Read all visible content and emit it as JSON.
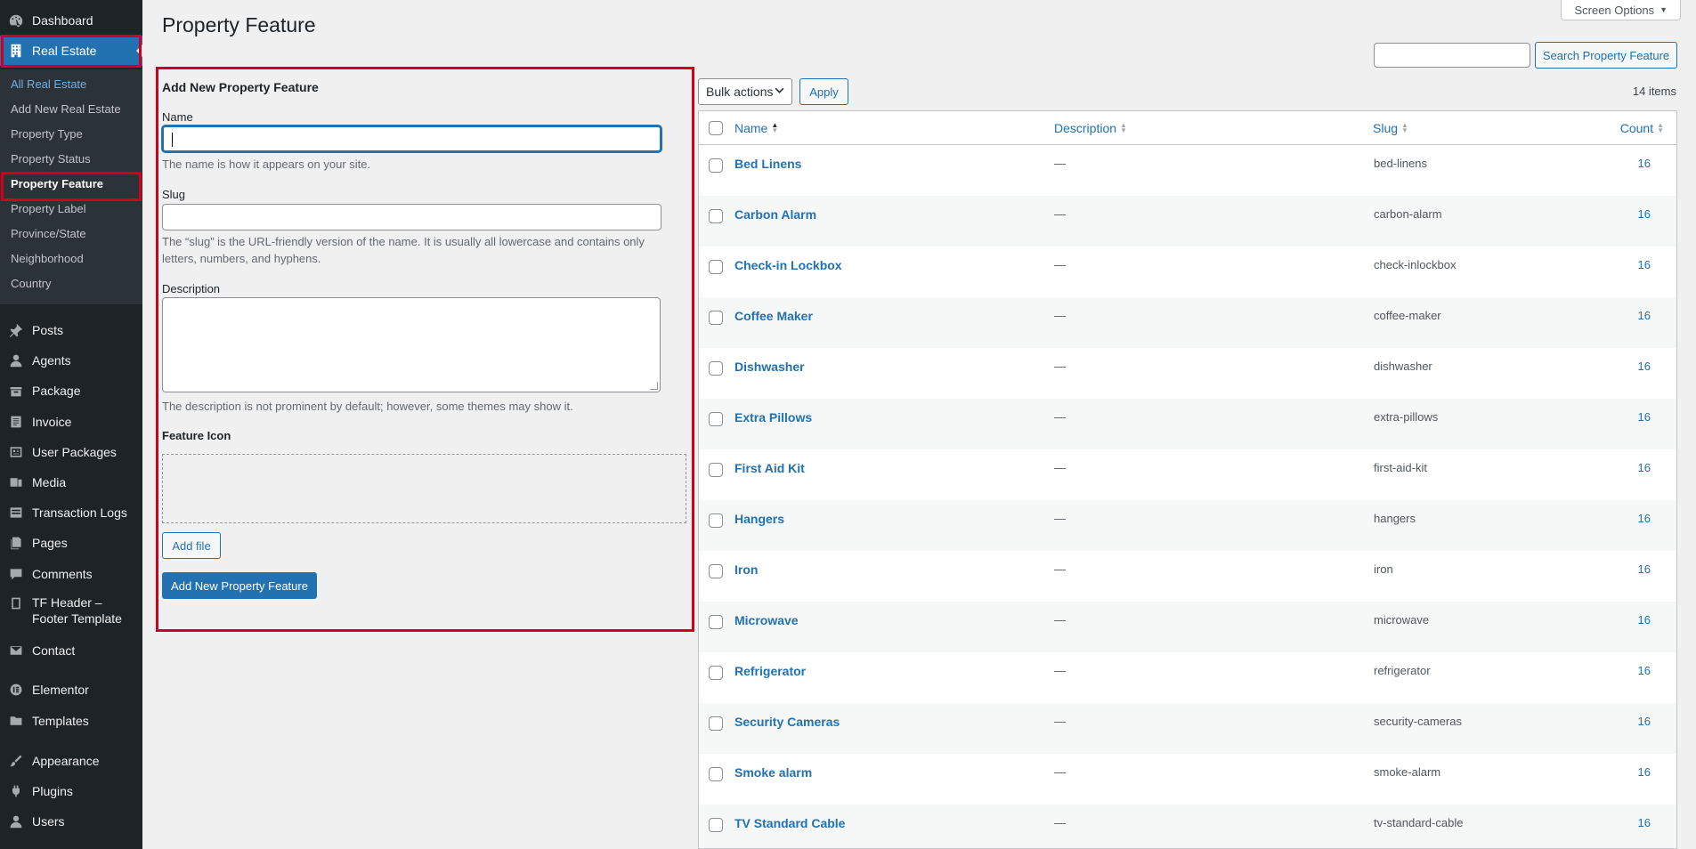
{
  "sidebar": {
    "dashboard": "Dashboard",
    "real_estate": "Real Estate",
    "submenu": [
      "All Real Estate",
      "Add New Real Estate",
      "Property Type",
      "Property Status",
      "Property Feature",
      "Property Label",
      "Province/State",
      "Neighborhood",
      "Country"
    ],
    "items": [
      "Posts",
      "Agents",
      "Package",
      "Invoice",
      "User Packages",
      "Media",
      "Transaction Logs",
      "Pages",
      "Comments"
    ],
    "tf_line1": "TF Header –",
    "tf_line2": "Footer Template",
    "contact": "Contact",
    "elementor": "Elementor",
    "templates": "Templates",
    "appearance": "Appearance",
    "plugins": "Plugins",
    "users": "Users"
  },
  "page": {
    "title": "Property Feature",
    "screen_options": "Screen Options"
  },
  "form": {
    "heading": "Add New Property Feature",
    "name_label": "Name",
    "name_value": "",
    "name_help": "The name is how it appears on your site.",
    "slug_label": "Slug",
    "slug_value": "",
    "slug_help_1": "The “slug” is the URL-friendly version of the name. It is usually all lowercase and contains only",
    "slug_help_2": "letters, numbers, and hyphens.",
    "desc_label": "Description",
    "desc_value": "",
    "desc_help": "The description is not prominent by default; however, some themes may show it.",
    "icon_label": "Feature Icon",
    "add_file": "Add file",
    "submit": "Add New Property Feature"
  },
  "search": {
    "value": "",
    "button": "Search Property Feature"
  },
  "bulk": {
    "selected": "Bulk actions",
    "apply": "Apply",
    "items_count": "14 items"
  },
  "table": {
    "columns": {
      "name": "Name",
      "description": "Description",
      "slug": "Slug",
      "count": "Count"
    },
    "rows": [
      {
        "name": "Bed Linens",
        "description": "—",
        "slug": "bed-linens",
        "count": "16"
      },
      {
        "name": "Carbon Alarm",
        "description": "—",
        "slug": "carbon-alarm",
        "count": "16"
      },
      {
        "name": "Check-in Lockbox",
        "description": "—",
        "slug": "check-inlockbox",
        "count": "16"
      },
      {
        "name": "Coffee Maker",
        "description": "—",
        "slug": "coffee-maker",
        "count": "16"
      },
      {
        "name": "Dishwasher",
        "description": "—",
        "slug": "dishwasher",
        "count": "16"
      },
      {
        "name": "Extra Pillows",
        "description": "—",
        "slug": "extra-pillows",
        "count": "16"
      },
      {
        "name": "First Aid Kit",
        "description": "—",
        "slug": "first-aid-kit",
        "count": "16"
      },
      {
        "name": "Hangers",
        "description": "—",
        "slug": "hangers",
        "count": "16"
      },
      {
        "name": "Iron",
        "description": "—",
        "slug": "iron",
        "count": "16"
      },
      {
        "name": "Microwave",
        "description": "—",
        "slug": "microwave",
        "count": "16"
      },
      {
        "name": "Refrigerator",
        "description": "—",
        "slug": "refrigerator",
        "count": "16"
      },
      {
        "name": "Security Cameras",
        "description": "—",
        "slug": "security-cameras",
        "count": "16"
      },
      {
        "name": "Smoke alarm",
        "description": "—",
        "slug": "smoke-alarm",
        "count": "16"
      },
      {
        "name": "TV Standard Cable",
        "description": "—",
        "slug": "tv-standard-cable",
        "count": "16"
      }
    ]
  },
  "colors": {
    "accent": "#2271b1",
    "sidebar": "#1d2327",
    "highlight": "#d0021b"
  }
}
